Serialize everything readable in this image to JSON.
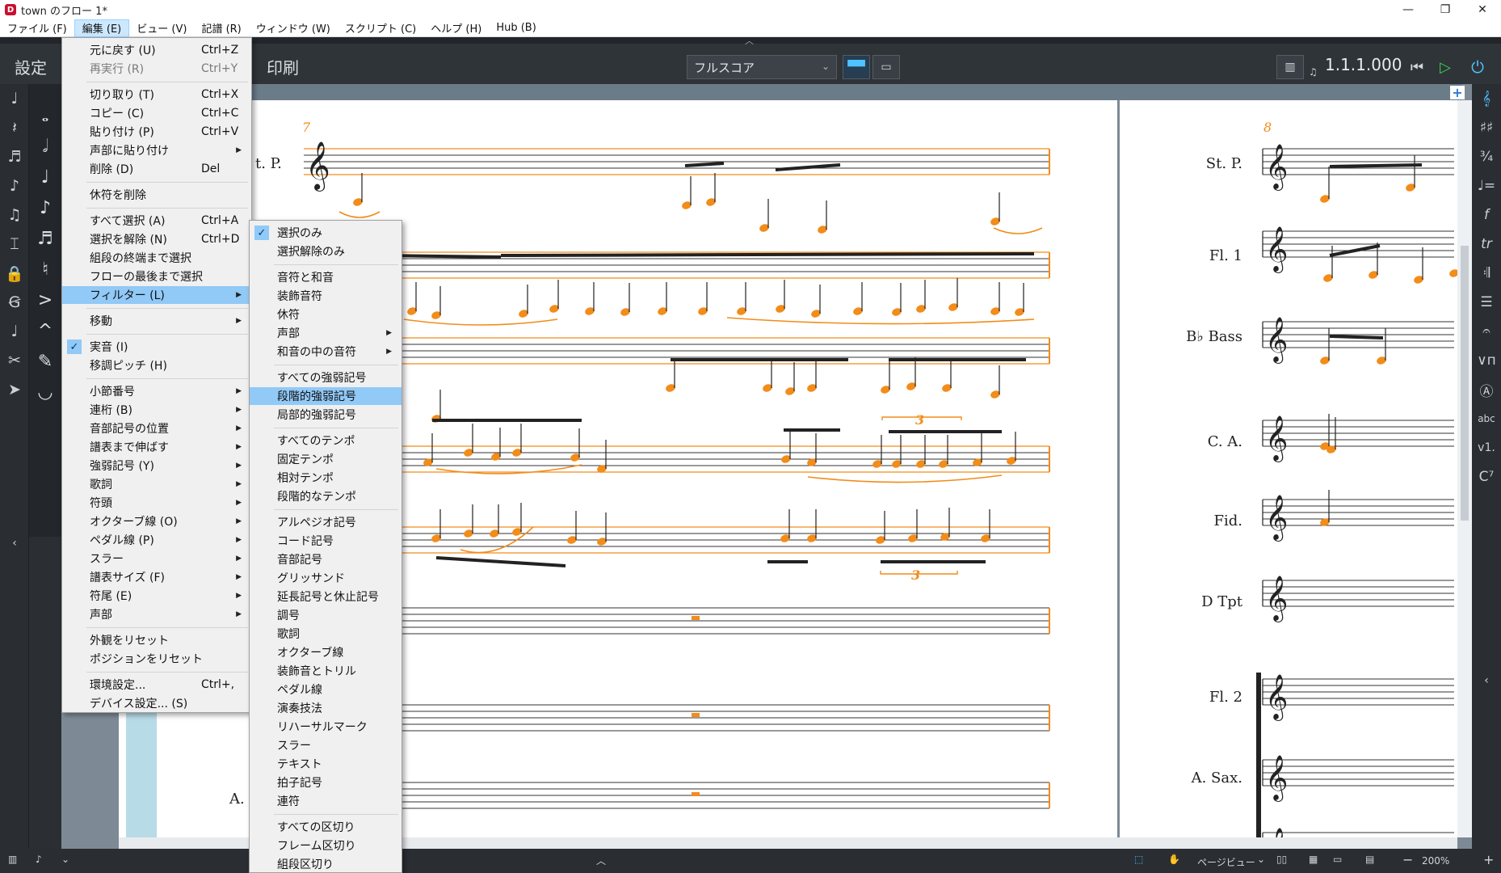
{
  "window": {
    "title": "town のフロー 1*",
    "controls": [
      "—",
      "❐",
      "✕"
    ]
  },
  "menubar": [
    {
      "label": "ファイル (F)",
      "open": false
    },
    {
      "label": "編集 (E)",
      "open": true
    },
    {
      "label": "ビュー (V)",
      "open": false
    },
    {
      "label": "記譜 (R)",
      "open": false
    },
    {
      "label": "ウィンドウ (W)",
      "open": false
    },
    {
      "label": "スクリプト (C)",
      "open": false
    },
    {
      "label": "ヘルプ (H)",
      "open": false
    },
    {
      "label": "Hub (B)",
      "open": false
    }
  ],
  "toolbar": {
    "mode_setup": "設定",
    "mode_print": "印刷",
    "layout_select": "フルスコア",
    "position": "1.1.1.000"
  },
  "edit_menu": [
    {
      "label": "元に戻す (U)",
      "shortcut": "Ctrl+Z"
    },
    {
      "label": "再実行 (R)",
      "shortcut": "Ctrl+Y",
      "disabled": true
    },
    {
      "sep": true
    },
    {
      "label": "切り取り (T)",
      "shortcut": "Ctrl+X"
    },
    {
      "label": "コピー (C)",
      "shortcut": "Ctrl+C"
    },
    {
      "label": "貼り付け (P)",
      "shortcut": "Ctrl+V"
    },
    {
      "label": "声部に貼り付け",
      "submenu": true
    },
    {
      "label": "削除 (D)",
      "shortcut": "Del"
    },
    {
      "sep": true
    },
    {
      "label": "休符を削除"
    },
    {
      "sep": true
    },
    {
      "label": "すべて選択 (A)",
      "shortcut": "Ctrl+A"
    },
    {
      "label": "選択を解除 (N)",
      "shortcut": "Ctrl+D"
    },
    {
      "label": "組段の終端まで選択"
    },
    {
      "label": "フローの最後まで選択"
    },
    {
      "label": "フィルター (L)",
      "submenu": true,
      "highlighted": true
    },
    {
      "sep": true
    },
    {
      "label": "移動",
      "submenu": true
    },
    {
      "sep": true
    },
    {
      "label": "実音 (I)",
      "checked": true
    },
    {
      "label": "移調ピッチ (H)"
    },
    {
      "sep": true
    },
    {
      "label": "小節番号",
      "submenu": true
    },
    {
      "label": "連桁 (B)",
      "submenu": true
    },
    {
      "label": "音部記号の位置",
      "submenu": true
    },
    {
      "label": "譜表まで伸ばす",
      "submenu": true
    },
    {
      "label": "強弱記号 (Y)",
      "submenu": true
    },
    {
      "label": "歌詞",
      "submenu": true
    },
    {
      "label": "符頭",
      "submenu": true
    },
    {
      "label": "オクターブ線 (O)",
      "submenu": true
    },
    {
      "label": "ペダル線 (P)",
      "submenu": true
    },
    {
      "label": "スラー",
      "submenu": true
    },
    {
      "label": "譜表サイズ (F)",
      "submenu": true
    },
    {
      "label": "符尾 (E)",
      "submenu": true
    },
    {
      "label": "声部",
      "submenu": true
    },
    {
      "sep": true
    },
    {
      "label": "外観をリセット"
    },
    {
      "label": "ポジションをリセット"
    },
    {
      "sep": true
    },
    {
      "label": "環境設定...",
      "shortcut": "Ctrl+,"
    },
    {
      "label": "デバイス設定... (S)"
    }
  ],
  "filter_menu": [
    {
      "label": "選択のみ",
      "checked": true
    },
    {
      "label": "選択解除のみ"
    },
    {
      "sep": true
    },
    {
      "label": "音符と和音"
    },
    {
      "label": "装飾音符"
    },
    {
      "label": "休符"
    },
    {
      "label": "声部",
      "submenu": true
    },
    {
      "label": "和音の中の音符",
      "submenu": true
    },
    {
      "sep": true
    },
    {
      "label": "すべての強弱記号"
    },
    {
      "label": "段階的強弱記号",
      "highlighted": true
    },
    {
      "label": "局部的強弱記号"
    },
    {
      "sep": true
    },
    {
      "label": "すべてのテンポ"
    },
    {
      "label": "固定テンポ"
    },
    {
      "label": "相対テンポ"
    },
    {
      "label": "段階的なテンポ"
    },
    {
      "sep": true
    },
    {
      "label": "アルペジオ記号"
    },
    {
      "label": "コード記号"
    },
    {
      "label": "音部記号"
    },
    {
      "label": "グリッサンド"
    },
    {
      "label": "延長記号と休止記号"
    },
    {
      "label": "調号"
    },
    {
      "label": "歌詞"
    },
    {
      "label": "オクターブ線"
    },
    {
      "label": "装飾音とトリル"
    },
    {
      "label": "ペダル線"
    },
    {
      "label": "演奏技法"
    },
    {
      "label": "リハーサルマーク"
    },
    {
      "label": "スラー"
    },
    {
      "label": "テキスト"
    },
    {
      "label": "拍子記号"
    },
    {
      "label": "連符"
    },
    {
      "sep": true
    },
    {
      "label": "すべての区切り"
    },
    {
      "label": "フレーム区切り"
    },
    {
      "label": "組段区切り"
    }
  ],
  "score": {
    "bar_left": "7",
    "bar_right": "8",
    "tuplet": "3",
    "left_instruments": [
      "t. P.",
      "A."
    ],
    "right_instruments": [
      "St. P.",
      "Fl. 1",
      "B♭ Bass",
      "C. A.",
      "Fid.",
      "D Tpt",
      "Fl. 2",
      "A. Sax."
    ],
    "accent_color": "#f28c1a"
  },
  "statusbar": {
    "view_select": "ページビュー",
    "zoom": "200%"
  }
}
